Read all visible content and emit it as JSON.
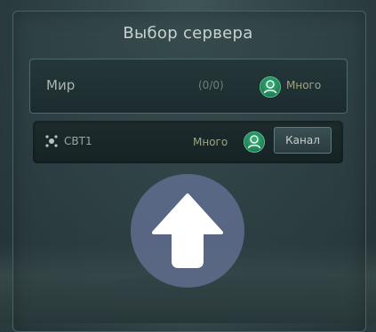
{
  "dialog": {
    "title": "Выбор сервера"
  },
  "world": {
    "name": "Мир",
    "count": "(0/0)",
    "population": "Много",
    "population_icon": "population-person-icon"
  },
  "channel": {
    "name": "СВТ1",
    "icon": "channel-status-icon",
    "population": "Много",
    "population_icon": "population-person-icon",
    "button_label": "Канал"
  },
  "overlay": {
    "icon": "arrow-up-icon"
  },
  "colors": {
    "accent_green": "#2a9a67",
    "population_text": "#9fa57a",
    "overlay_circle": "#5f6c8c"
  }
}
